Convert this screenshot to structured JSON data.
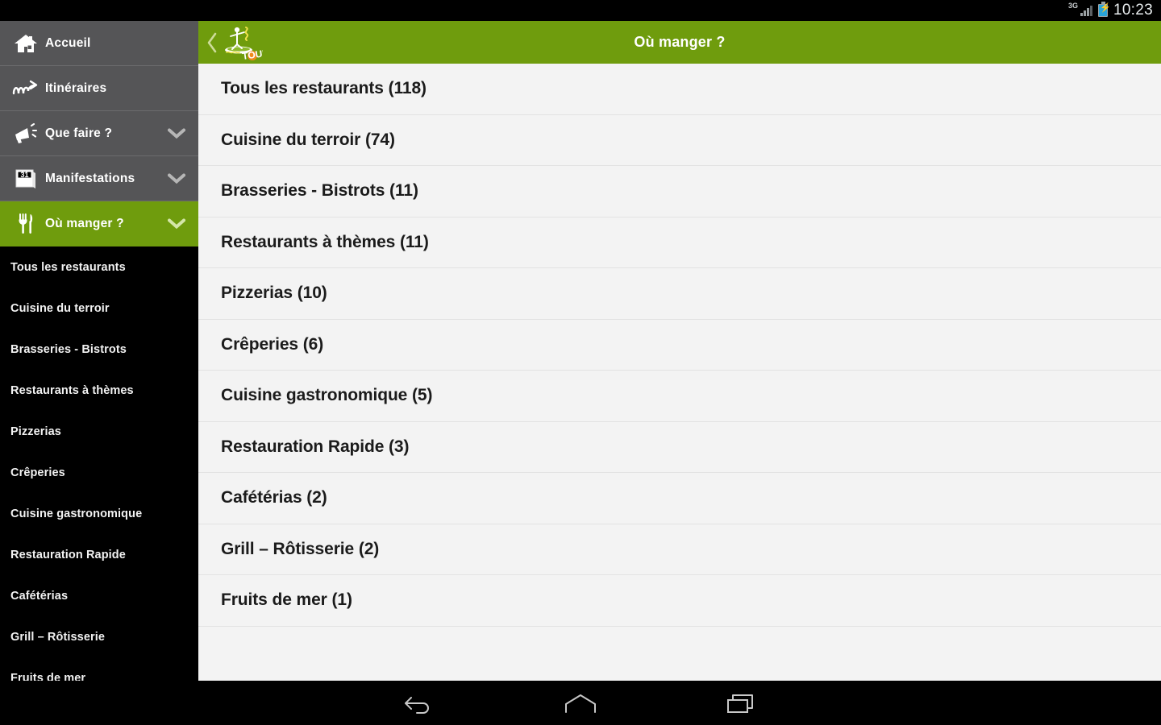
{
  "status_bar": {
    "network_label": "3G",
    "network_icon": "signal-bars-icon",
    "battery_icon": "battery-charging-icon",
    "time": "10:23"
  },
  "sidebar": {
    "items": [
      {
        "label": "Accueil",
        "icon": "home-icon",
        "expandable": false,
        "active": false
      },
      {
        "label": "Itinéraires",
        "icon": "route-icon",
        "expandable": false,
        "active": false
      },
      {
        "label": "Que faire ?",
        "icon": "megaphone-icon",
        "expandable": true,
        "active": false
      },
      {
        "label": "Manifestations",
        "icon": "calendar-icon",
        "expandable": true,
        "active": false
      },
      {
        "label": "Où manger ?",
        "icon": "cutlery-icon",
        "expandable": true,
        "active": true
      }
    ],
    "subitems": [
      {
        "label": "Tous les restaurants"
      },
      {
        "label": "Cuisine du terroir"
      },
      {
        "label": "Brasseries - Bistrots"
      },
      {
        "label": "Restaurants à thèmes"
      },
      {
        "label": "Pizzerias"
      },
      {
        "label": "Crêperies"
      },
      {
        "label": "Cuisine gastronomique"
      },
      {
        "label": "Restauration Rapide"
      },
      {
        "label": "Cafétérias"
      },
      {
        "label": "Grill – Rôtisserie"
      },
      {
        "label": "Fruits de mer"
      }
    ],
    "calendar_day": "31"
  },
  "appbar": {
    "title": "Où manger ?",
    "back_icon": "chevron-left-icon",
    "logo_name": "paddleboard-tour-logo",
    "logo_text": "TOUR"
  },
  "list": {
    "rows": [
      {
        "label": "Tous les restaurants (118)"
      },
      {
        "label": "Cuisine du terroir (74)"
      },
      {
        "label": "Brasseries - Bistrots (11)"
      },
      {
        "label": "Restaurants à thèmes (11)"
      },
      {
        "label": "Pizzerias (10)"
      },
      {
        "label": "Crêperies (6)"
      },
      {
        "label": "Cuisine gastronomique (5)"
      },
      {
        "label": "Restauration Rapide (3)"
      },
      {
        "label": "Cafétérias (2)"
      },
      {
        "label": "Grill – Rôtisserie (2)"
      },
      {
        "label": "Fruits de mer (1)"
      }
    ]
  },
  "navbar": {
    "buttons": [
      {
        "icon": "back-icon"
      },
      {
        "icon": "home-icon"
      },
      {
        "icon": "recents-icon"
      }
    ]
  },
  "colors": {
    "accent_green": "#6f9c0d",
    "sidebar_gray": "#555557",
    "submenu_black": "#000000",
    "list_background": "#f3f3f3",
    "list_text": "#1b1b1b"
  }
}
